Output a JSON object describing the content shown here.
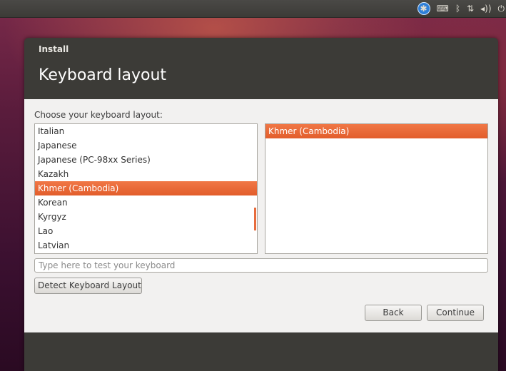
{
  "window": {
    "title": "Install",
    "heading": "Keyboard layout"
  },
  "keyboard": {
    "prompt": "Choose your keyboard layout:",
    "layouts": [
      {
        "label": "Italian",
        "selected": false
      },
      {
        "label": "Japanese",
        "selected": false
      },
      {
        "label": "Japanese (PC-98xx Series)",
        "selected": false
      },
      {
        "label": "Kazakh",
        "selected": false
      },
      {
        "label": "Khmer (Cambodia)",
        "selected": true
      },
      {
        "label": "Korean",
        "selected": false
      },
      {
        "label": "Kyrgyz",
        "selected": false
      },
      {
        "label": "Lao",
        "selected": false
      },
      {
        "label": "Latvian",
        "selected": false
      }
    ],
    "variants": [
      {
        "label": "Khmer (Cambodia)",
        "selected": true
      }
    ],
    "test_placeholder": "Type here to test your keyboard",
    "test_value": "",
    "detect_label": "Detect Keyboard Layout"
  },
  "nav": {
    "back_label": "Back",
    "continue_label": "Continue"
  },
  "panel": {
    "indicators": [
      {
        "name": "accessibility-icon",
        "glyph": "✱"
      },
      {
        "name": "keyboard-icon",
        "glyph": "⌨"
      },
      {
        "name": "bluetooth-icon",
        "glyph": "ᛒ"
      },
      {
        "name": "network-icon",
        "glyph": "⇅"
      },
      {
        "name": "volume-icon",
        "glyph": "◂))"
      },
      {
        "name": "power-icon",
        "glyph": "⏻"
      }
    ]
  },
  "colors": {
    "accent": "#e25d2b",
    "window_dark": "#3c3b37",
    "content_bg": "#f2f1f0"
  }
}
